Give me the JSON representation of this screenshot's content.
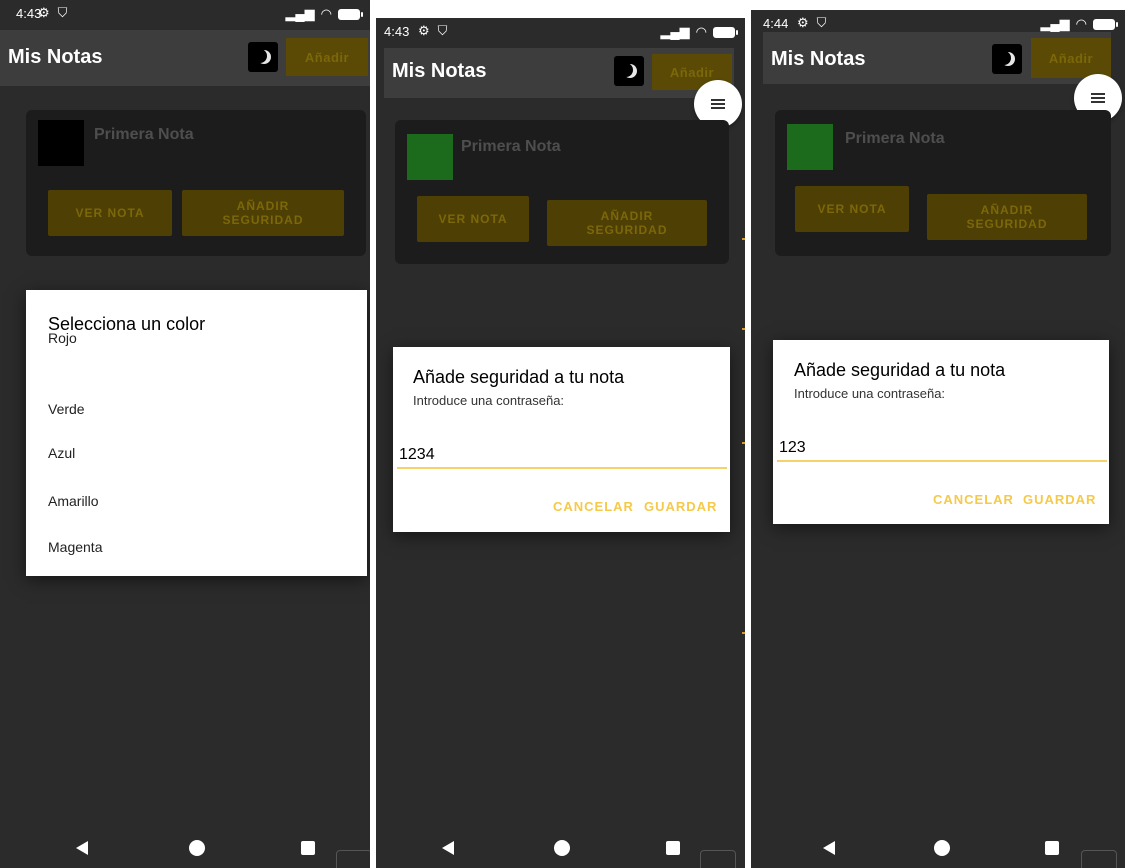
{
  "screens": [
    {
      "time": "4:43",
      "app_title": "Mis Notas",
      "add_label": "Añadir",
      "note_title": "Primera Nota",
      "view_label": "VER NOTA",
      "security_label_line1": "AÑADIR",
      "security_label_line2": "SEGURIDAD",
      "swatch_color": "#000000",
      "dialog": {
        "title": "Selecciona un color",
        "options": [
          "Rojo",
          "Verde",
          "Azul",
          "Amarillo",
          "Magenta"
        ]
      }
    },
    {
      "time": "4:43",
      "app_title": "Mis Notas",
      "add_label": "Añadir",
      "note_title": "Primera Nota",
      "view_label": "VER NOTA",
      "security_label_line1": "AÑADIR",
      "security_label_line2": "SEGURIDAD",
      "swatch_color": "#1c6b1c",
      "dialog": {
        "title": "Añade seguridad a tu nota",
        "subtitle": "Introduce una contraseña:",
        "password": "1234",
        "cancel": "CANCELAR",
        "save": "GUARDAR"
      }
    },
    {
      "time": "4:44",
      "app_title": "Mis Notas",
      "add_label": "Añadir",
      "note_title": "Primera Nota",
      "view_label": "VER NOTA",
      "security_label_line1": "AÑADIR",
      "security_label_line2": "SEGURIDAD",
      "swatch_color": "#1c6b1c",
      "dialog": {
        "title": "Añade seguridad a tu nota",
        "subtitle": "Introduce una contraseña:",
        "password": "123",
        "cancel": "CANCELAR",
        "save": "GUARDAR"
      }
    }
  ],
  "icons": {
    "settings": "gear-icon",
    "shield": "shield-icon",
    "signal": "signal-icon",
    "wifi": "wifi-icon",
    "battery": "battery-icon",
    "moon": "moon-icon",
    "menu": "menu-icon",
    "back": "back-icon",
    "home": "home-icon",
    "recents": "recents-icon"
  },
  "colors": {
    "background": "#2b2b2b",
    "accent": "#f5c94a",
    "button_dim": "#4e4004"
  }
}
